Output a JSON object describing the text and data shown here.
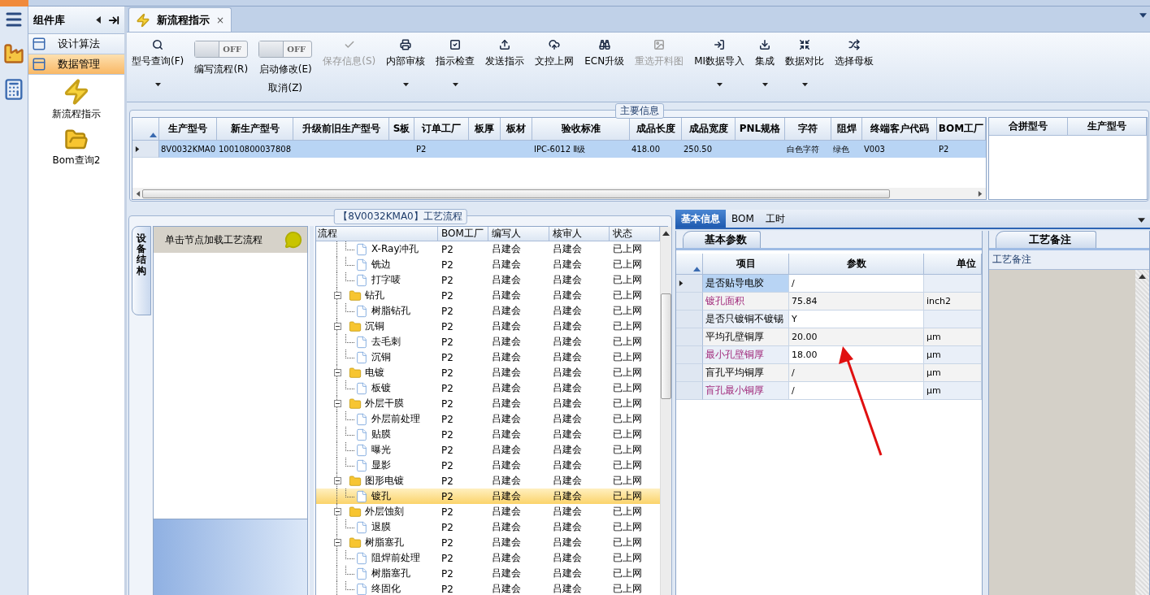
{
  "library": {
    "title": "组件库",
    "categories": [
      {
        "label": "设计算法",
        "selected": false
      },
      {
        "label": "数据管理",
        "selected": true
      }
    ],
    "items": [
      {
        "label": "新流程指示"
      },
      {
        "label": "Bom查询2"
      }
    ]
  },
  "document_tab": {
    "label": "新流程指示",
    "close": "×",
    "selected": true
  },
  "toolbar": [
    {
      "kind": "button",
      "label": "型号查询(F)",
      "disabled": false,
      "dropdown": true
    },
    {
      "kind": "toggle",
      "label": "编写流程(R)",
      "switch_text": "OFF",
      "on": false
    },
    {
      "kind": "toggle",
      "label": "启动修改(E)",
      "label_2": "取消(Z)",
      "switch_text": "OFF",
      "on": false
    },
    {
      "kind": "button",
      "label": "保存信息(S)",
      "disabled": true,
      "dropdown": false
    },
    {
      "kind": "button",
      "label": "内部审核",
      "disabled": false,
      "dropdown": true
    },
    {
      "kind": "button",
      "label": "指示检查",
      "disabled": false,
      "dropdown": true
    },
    {
      "kind": "button",
      "label": "发送指示",
      "disabled": false,
      "dropdown": false
    },
    {
      "kind": "button",
      "label": "文控上网",
      "disabled": false,
      "dropdown": false
    },
    {
      "kind": "button",
      "label": "ECN升级",
      "disabled": false,
      "dropdown": false
    },
    {
      "kind": "button",
      "label": "重选开料图",
      "disabled": true,
      "dropdown": false
    },
    {
      "kind": "button",
      "label": "MI数据导入",
      "disabled": false,
      "dropdown": true
    },
    {
      "kind": "button",
      "label": "集成",
      "disabled": false,
      "dropdown": true
    },
    {
      "kind": "button",
      "label": "数据对比",
      "disabled": false,
      "dropdown": true
    },
    {
      "kind": "button",
      "label": "选择母板",
      "disabled": false,
      "dropdown": false
    }
  ],
  "main_info": {
    "title": "主要信息",
    "columns": [
      "生产型号",
      "新生产型号",
      "升级前旧生产型号",
      "S板",
      "订单工厂",
      "板厚",
      "板材",
      "验收标准",
      "成品长度",
      "成品宽度",
      "PNL规格",
      "字符",
      "阻焊",
      "终端客户代码",
      "BOM工厂"
    ],
    "rows": [
      {
        "selected": true,
        "cells": [
          "8V0032KMA0",
          "10010800037808",
          null,
          null,
          "P2",
          null,
          null,
          "IPC-6012 Ⅱ级",
          "418.00",
          "250.50",
          null,
          "白色字符",
          "绿色",
          "V003",
          "P2"
        ]
      }
    ],
    "side_columns": [
      "合拼型号",
      "生产型号"
    ]
  },
  "process": {
    "title": "【8V0032KMA0】工艺流程",
    "side_tab": "设备结构",
    "hint": "单击节点加载工艺流程",
    "columns": [
      "流程",
      "BOM工厂",
      "编写人",
      "核审人",
      "状态"
    ],
    "nodes": [
      {
        "children": [
          {
            "label": "X-Ray冲孔",
            "cells": [
              "P2",
              "吕建会",
              "吕建会",
              "已上网"
            ],
            "selected": false
          },
          {
            "label": "铣边",
            "cells": [
              "P2",
              "吕建会",
              "吕建会",
              "已上网"
            ],
            "selected": false
          },
          {
            "label": "打字唛",
            "cells": [
              "P2",
              "吕建会",
              "吕建会",
              "已上网"
            ],
            "selected": false
          }
        ]
      },
      {
        "label": "钻孔",
        "cells": [
          "P2",
          "吕建会",
          "吕建会",
          "已上网"
        ],
        "selected": false,
        "expanded": true,
        "children": [
          {
            "label": "树脂钻孔",
            "cells": [
              "P2",
              "吕建会",
              "吕建会",
              "已上网"
            ],
            "selected": false
          }
        ]
      },
      {
        "label": "沉铜",
        "cells": [
          "P2",
          "吕建会",
          "吕建会",
          "已上网"
        ],
        "selected": false,
        "expanded": true,
        "children": [
          {
            "label": "去毛刺",
            "cells": [
              "P2",
              "吕建会",
              "吕建会",
              "已上网"
            ],
            "selected": false
          },
          {
            "label": "沉铜",
            "cells": [
              "P2",
              "吕建会",
              "吕建会",
              "已上网"
            ],
            "selected": false
          }
        ]
      },
      {
        "label": "电镀",
        "cells": [
          "P2",
          "吕建会",
          "吕建会",
          "已上网"
        ],
        "selected": false,
        "expanded": true,
        "children": [
          {
            "label": "板镀",
            "cells": [
              "P2",
              "吕建会",
              "吕建会",
              "已上网"
            ],
            "selected": false
          }
        ]
      },
      {
        "label": "外层干膜",
        "cells": [
          "P2",
          "吕建会",
          "吕建会",
          "已上网"
        ],
        "selected": false,
        "expanded": true,
        "children": [
          {
            "label": "外层前处理",
            "cells": [
              "P2",
              "吕建会",
              "吕建会",
              "已上网"
            ],
            "selected": false
          },
          {
            "label": "贴膜",
            "cells": [
              "P2",
              "吕建会",
              "吕建会",
              "已上网"
            ],
            "selected": false
          },
          {
            "label": "曝光",
            "cells": [
              "P2",
              "吕建会",
              "吕建会",
              "已上网"
            ],
            "selected": false
          },
          {
            "label": "显影",
            "cells": [
              "P2",
              "吕建会",
              "吕建会",
              "已上网"
            ],
            "selected": false
          }
        ]
      },
      {
        "label": "图形电镀",
        "cells": [
          "P2",
          "吕建会",
          "吕建会",
          "已上网"
        ],
        "selected": false,
        "expanded": true,
        "children": [
          {
            "label": "镀孔",
            "cells": [
              "P2",
              "吕建会",
              "吕建会",
              "已上网"
            ],
            "selected": true
          }
        ]
      },
      {
        "label": "外层蚀刻",
        "cells": [
          "P2",
          "吕建会",
          "吕建会",
          "已上网"
        ],
        "selected": false,
        "expanded": true,
        "children": [
          {
            "label": "退膜",
            "cells": [
              "P2",
              "吕建会",
              "吕建会",
              "已上网"
            ],
            "selected": false
          }
        ]
      },
      {
        "label": "树脂塞孔",
        "cells": [
          "P2",
          "吕建会",
          "吕建会",
          "已上网"
        ],
        "selected": false,
        "expanded": true,
        "children": [
          {
            "label": "阻焊前处理",
            "cells": [
              "P2",
              "吕建会",
              "吕建会",
              "已上网"
            ],
            "selected": false
          },
          {
            "label": "树脂塞孔",
            "cells": [
              "P2",
              "吕建会",
              "吕建会",
              "已上网"
            ],
            "selected": false
          },
          {
            "label": "终固化",
            "cells": [
              "P2",
              "吕建会",
              "吕建会",
              "已上网"
            ],
            "selected": false
          }
        ]
      }
    ]
  },
  "detail": {
    "tabs": [
      {
        "label": "基本信息",
        "selected": true
      },
      {
        "label": "BOM",
        "selected": false
      },
      {
        "label": "工时",
        "selected": false
      }
    ],
    "params": {
      "title": "基本参数",
      "columns": [
        "项目",
        "参数",
        "单位"
      ],
      "rows": [
        {
          "item": "是否贴导电胶",
          "value": "/",
          "selected": true,
          "highlighted": false
        },
        {
          "item": "镀孔面积",
          "value": "75.84",
          "unit": "inch2",
          "selected": false,
          "highlighted": true
        },
        {
          "item": "是否只镀铜不镀锡",
          "value": "Y",
          "selected": false,
          "highlighted": false
        },
        {
          "item": "平均孔壁铜厚",
          "value": "20.00",
          "unit": "μm",
          "selected": false,
          "highlighted": false
        },
        {
          "item": "最小孔壁铜厚",
          "value": "18.00",
          "unit": "μm",
          "selected": false,
          "highlighted": true
        },
        {
          "item": "盲孔平均铜厚",
          "value": "/",
          "unit": "μm",
          "selected": false,
          "highlighted": false
        },
        {
          "item": "盲孔最小铜厚",
          "value": "/",
          "unit": "μm",
          "selected": false,
          "highlighted": true
        }
      ]
    },
    "notes": {
      "title": "工艺备注",
      "header": "工艺备注"
    }
  }
}
